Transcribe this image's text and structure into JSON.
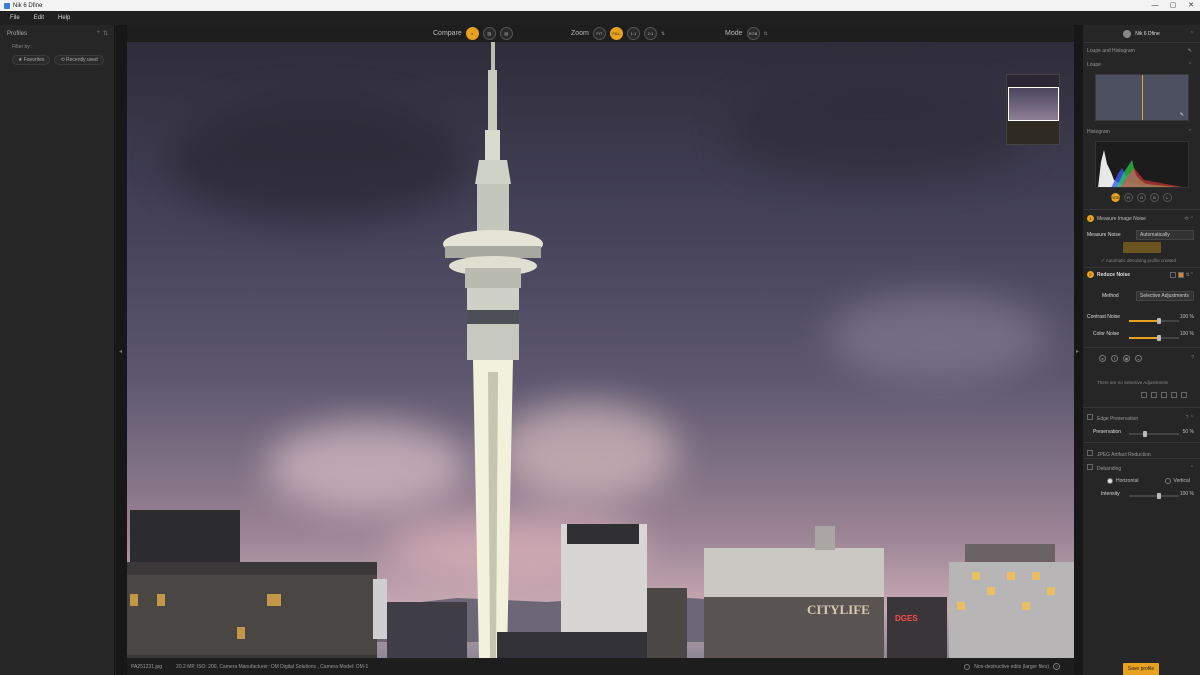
{
  "window": {
    "title": "Nik 6 Dfine",
    "min": "—",
    "max": "▢",
    "close": "✕"
  },
  "menu": [
    "File",
    "Edit",
    "Help"
  ],
  "left_panel": {
    "title": "Profiles",
    "filter_label": "Filter by:",
    "chips": [
      "Favorites",
      "Recently used"
    ]
  },
  "toolbar": {
    "compare_label": "Compare",
    "zoom_label": "Zoom",
    "zoom_options": [
      "FIT",
      "FILL",
      "1:1",
      "2:1"
    ],
    "zoom_active": "FILL",
    "mode_label": "Mode",
    "mode_value": "RGB"
  },
  "statusbar": {
    "filename": "PA251231.jpg",
    "meta": "20.2 MP, ISO: 200, Camera Manufacturer: OM Digital Solutions , Camera Model: OM-1",
    "nde_label": "Non-destructive edits (larger files)"
  },
  "right_panel": {
    "brand": "Nik 6 Dfine",
    "section_loupe_histo": "Loupe and Histogram",
    "loupe_label": "Loupe",
    "histogram_label": "Histogram",
    "channels": [
      "RGB",
      "R",
      "G",
      "B",
      "L"
    ],
    "step1_num": "1",
    "step1_title": "Measure Image Noise",
    "measure_label": "Measure Noise",
    "measure_value": "Automatically",
    "auto_note": "✓ Automatic denoising profile created",
    "step2_num": "2",
    "step2_title": "Reduce Noise",
    "method_label": "Method",
    "method_value": "Selective Adjustments",
    "contrast_label": "Contrast Noise",
    "contrast_value": "100 %",
    "contrast_level": 100,
    "color_label": "Color Noise",
    "color_value": "100 %",
    "color_level": 100,
    "no_adjust_text": "There are no Selective Adjustments",
    "edge_title": "Edge Preservation",
    "preservation_label": "Preservation",
    "preservation_value": "50 %",
    "preservation_level": 50,
    "jpeg_title": "JPEG Artifact Reduction",
    "debanding_title": "Debanding",
    "horizontal_label": "Horizontal",
    "vertical_label": "Vertical",
    "intensity_label": "Intensity",
    "intensity_value": "100 %",
    "intensity_level": 100,
    "save_label": "Save profile"
  },
  "photo_text": {
    "sign1": "CITYLIFE",
    "sign2": "DGES"
  },
  "colors": {
    "accent": "#e9a21f"
  }
}
